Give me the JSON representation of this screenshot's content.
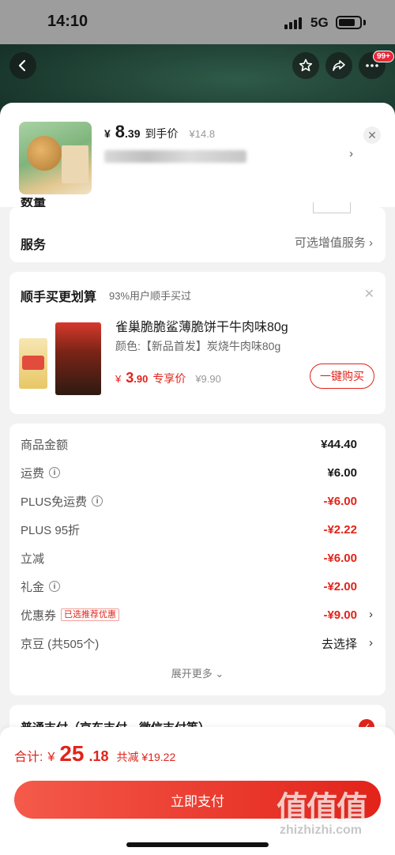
{
  "status_bar": {
    "time": "14:10",
    "network": "5G"
  },
  "header": {
    "badge": "99+"
  },
  "product": {
    "currency": "¥",
    "price_int": "8",
    "price_dec": ".39",
    "price_label": "到手价",
    "original_price": "¥14.8"
  },
  "quantity": {
    "label": "数量"
  },
  "service": {
    "label": "服务",
    "value": "可选增值服务"
  },
  "bundle": {
    "title": "顺手买更划算",
    "subtitle": "93%用户顺手买过",
    "name": "雀巢脆脆鲨薄脆饼干牛肉味80g",
    "spec": "颜色:【新品首发】炭烧牛肉味80g",
    "currency": "¥",
    "price_int": "3",
    "price_dec": ".90",
    "price_tag": "专享价",
    "original_price": "¥9.90",
    "buy_label": "一键购买"
  },
  "fees": {
    "goods_label": "商品金额",
    "goods_value": "¥44.40",
    "shipping_label": "运费",
    "shipping_value": "¥6.00",
    "plus_ship_label": "PLUS免运费",
    "plus_ship_value": "-¥6.00",
    "plus_discount_label": "PLUS 95折",
    "plus_discount_value": "-¥2.22",
    "instant_label": "立减",
    "instant_value": "-¥6.00",
    "gift_label": "礼金",
    "gift_value": "-¥2.00",
    "coupon_label": "优惠券",
    "coupon_tag": "已选推荐优惠",
    "coupon_value": "-¥9.00",
    "jd_bean_label": "京豆 (共505个)",
    "jd_bean_value": "去选择",
    "expand_label": "展开更多"
  },
  "payment": {
    "label": "普通支付（京东支付、微信支付等）"
  },
  "footer": {
    "total_label": "合计:",
    "currency": "¥",
    "total_int": "25",
    "total_dec": ".18",
    "saved": "共减 ¥19.22",
    "pay_label": "立即支付"
  },
  "watermark": {
    "text": "值值值",
    "url": "zhizhizhi.com"
  },
  "colors": {
    "accent": "#e2231a",
    "hero_green": "#1e3f33"
  }
}
